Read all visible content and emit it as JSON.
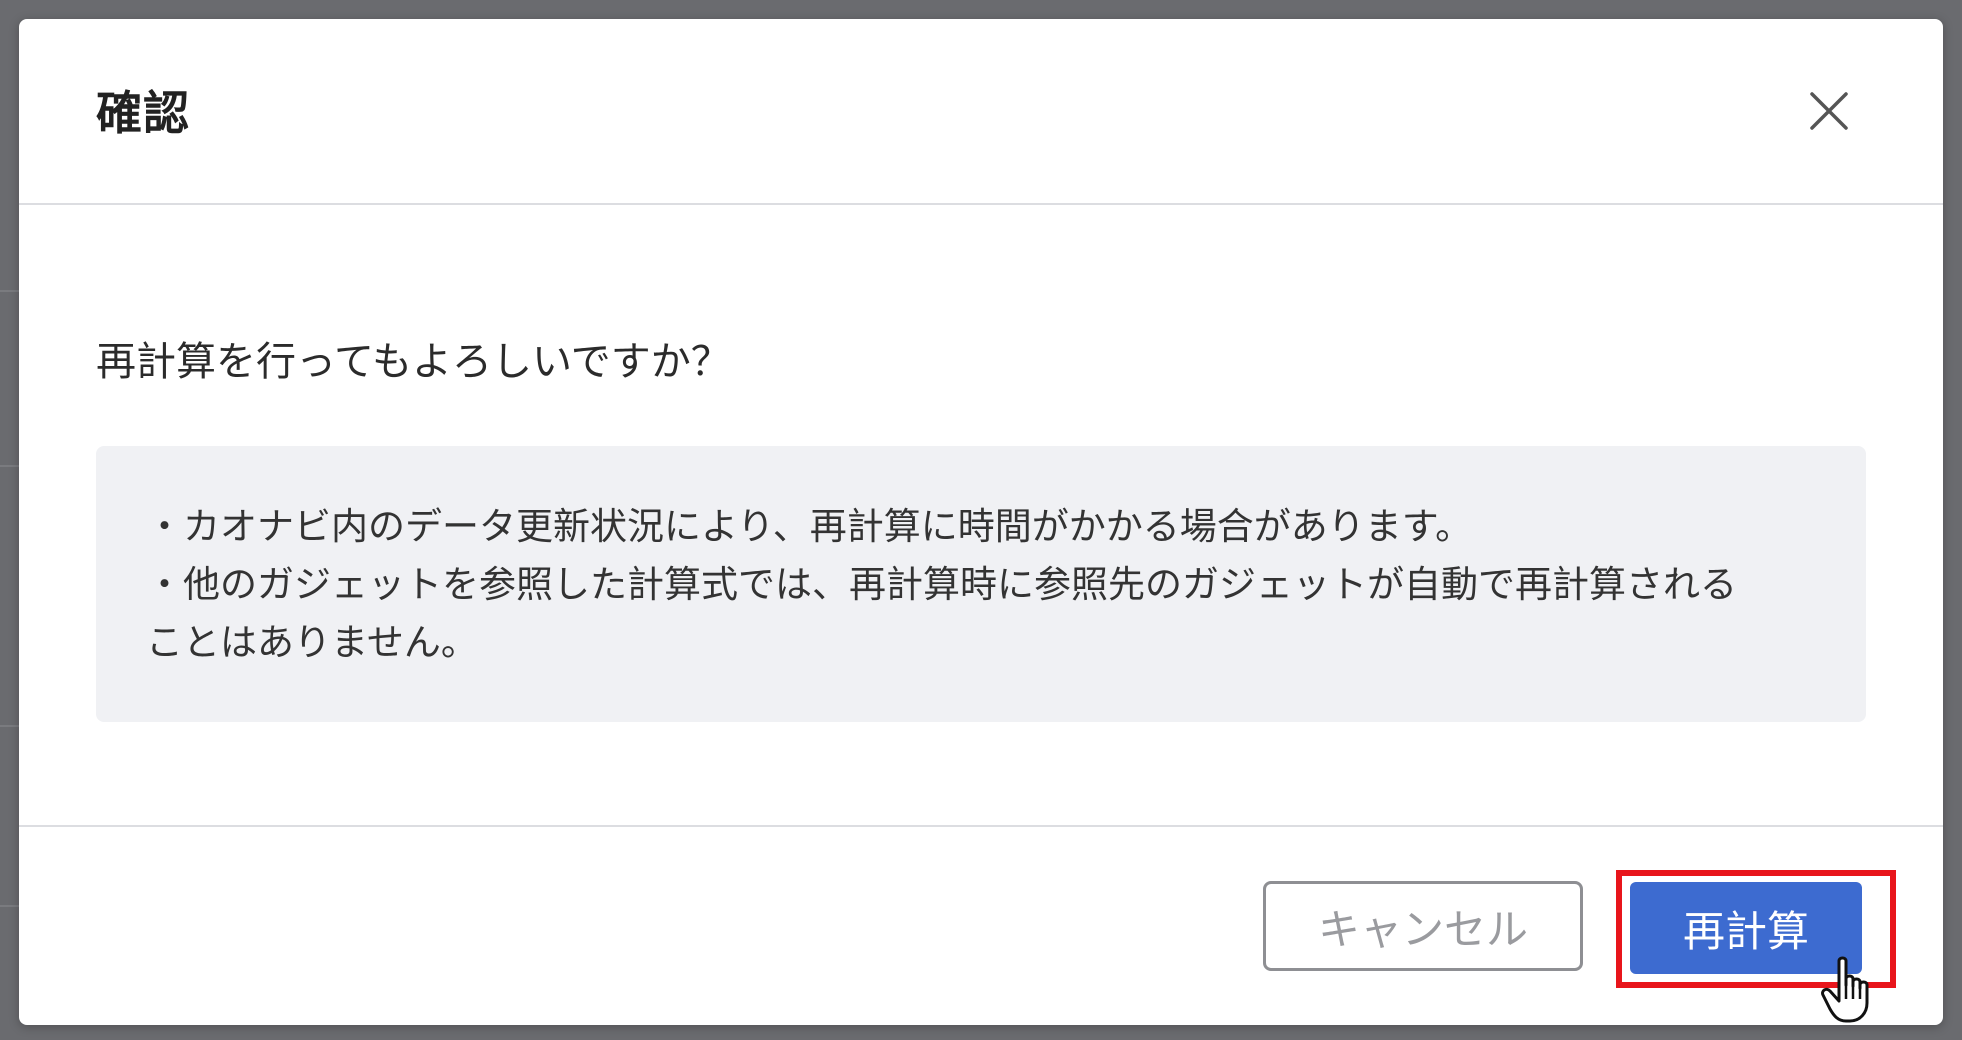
{
  "dialog": {
    "title": "確認",
    "close_icon": "close-icon",
    "question": "再計算を行ってもよろしいですか？",
    "notes": [
      "・カオナビ内のデータ更新状況により、再計算に時間がかかる場合があります。",
      "・他のガジェットを参照した計算式では、再計算時に参照先のガジェットが自動で再計算される",
      "ことはありません。"
    ],
    "footer": {
      "cancel_label": "キャンセル",
      "recalc_label": "再計算"
    }
  },
  "icons": {
    "cursor": "hand-pointer-icon"
  },
  "colors": {
    "primary": "#3d6bd0",
    "highlight": "#e8151b",
    "note_background": "#f0f1f4",
    "overlay": "#6a6b6f"
  }
}
